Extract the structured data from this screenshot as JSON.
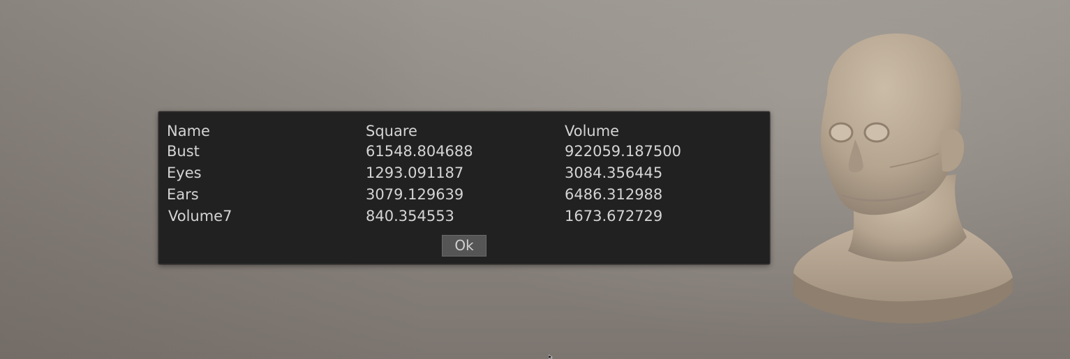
{
  "dialog": {
    "headers": {
      "name": "Name",
      "square": "Square",
      "volume": "Volume"
    },
    "rows": [
      {
        "name": "Bust",
        "square": "61548.804688",
        "volume": "922059.187500"
      },
      {
        "name": "Eyes",
        "square": "1293.091187",
        "volume": "3084.356445"
      },
      {
        "name": "Ears",
        "square": "3079.129639",
        "volume": "6486.312988"
      },
      {
        "name": "Volume7",
        "square": "840.354553",
        "volume": "1673.672729"
      }
    ],
    "ok_label": "Ok"
  },
  "colors": {
    "dialog_background": "#212121",
    "text": "#d4d4d4",
    "button_background": "#555555",
    "viewport_background": "#8d8781",
    "model_skin": "#b8a894"
  },
  "icons": {
    "model": "sculpted-head-bust-model",
    "cursor": "mouse-pointer-icon"
  }
}
